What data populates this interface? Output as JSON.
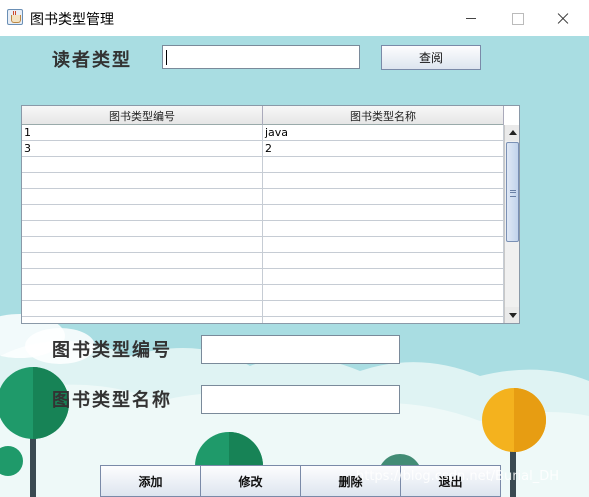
{
  "window": {
    "title": "图书类型管理"
  },
  "form": {
    "reader_type_label": "读者类型",
    "search_value": "",
    "search_button": "查阅",
    "type_id_label": "图书类型编号",
    "type_id_value": "",
    "type_name_label": "图书类型名称",
    "type_name_value": ""
  },
  "table": {
    "columns": [
      "图书类型编号",
      "图书类型名称"
    ],
    "rows": [
      [
        "1",
        "java"
      ],
      [
        "3",
        "2"
      ],
      [
        "",
        ""
      ],
      [
        "",
        ""
      ],
      [
        "",
        ""
      ],
      [
        "",
        ""
      ],
      [
        "",
        ""
      ],
      [
        "",
        ""
      ],
      [
        "",
        ""
      ],
      [
        "",
        ""
      ],
      [
        "",
        ""
      ],
      [
        "",
        ""
      ],
      [
        "",
        ""
      ]
    ]
  },
  "actions": {
    "add": "添加",
    "edit": "修改",
    "delete": "删除",
    "exit": "退出"
  },
  "watermark": "https://blog.csdn.net/Burial_DH",
  "colors": {
    "background": "#a9dde2",
    "tree_green": "#1f9a6a",
    "tree_yellow": "#f4b21e"
  }
}
